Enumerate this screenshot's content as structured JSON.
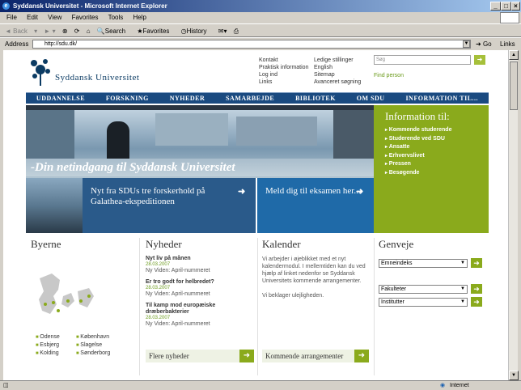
{
  "window": {
    "title": "Syddansk Universitet - Microsoft Internet Explorer"
  },
  "menu": [
    "File",
    "Edit",
    "View",
    "Favorites",
    "Tools",
    "Help"
  ],
  "toolbar": {
    "back": "Back",
    "search": "Search",
    "favorites": "Favorites",
    "history": "History"
  },
  "address": {
    "label": "Address",
    "url": "http://sdu.dk/",
    "go": "Go",
    "links": "Links"
  },
  "status": {
    "zone": "Internet"
  },
  "site": {
    "logo_text": "Syddansk Universitet",
    "toplinks_a": [
      "Kontakt",
      "Praktisk information",
      "Log ind",
      "Links"
    ],
    "toplinks_b": [
      "Ledige stillinger",
      "English",
      "Sitemap",
      "Avanceret søgning"
    ],
    "search_placeholder": "Søg",
    "find_person": "Find person",
    "nav": [
      "UDDANNELSE",
      "FORSKNING",
      "NYHEDER",
      "SAMARBEJDE",
      "BIBLIOTEK",
      "OM SDU",
      "INFORMATION TIL..."
    ],
    "slogan": "-Din netindgang til Syddansk Universitet",
    "info": {
      "title": "Information til:",
      "items": [
        "Kommende studerende",
        "Studerende ved SDU",
        "Ansatte",
        "Erhvervslivet",
        "Pressen",
        "Besøgende"
      ]
    },
    "promo1": "Nyt fra SDUs tre forskerhold på Galathea-ekspeditionen",
    "promo2": "Meld dig til eksamen her...",
    "byerne": {
      "title": "Byerne",
      "cities": [
        "Odense",
        "København",
        "Esbjerg",
        "Slagelse",
        "Kolding",
        "Sønderborg"
      ]
    },
    "nyheder": {
      "title": "Nyheder",
      "items": [
        {
          "title": "Nyt liv på månen",
          "date": "28.03.2007",
          "src": "Ny Viden: April-nummeret"
        },
        {
          "title": "Er tro godt for helbredet?",
          "date": "28.03.2007",
          "src": "Ny Viden: April-nummeret"
        },
        {
          "title": "Til kamp mod europæiske dræberbakterier",
          "date": "28.03.2007",
          "src": "Ny Viden: April-nummeret"
        }
      ],
      "more": "Flere nyheder"
    },
    "kalender": {
      "title": "Kalender",
      "text1": "Vi arbejder i øjeblikket med et nyt kalendermodul. I mellemtiden kan du ved hjælp af linket nedenfor se Syddansk Universitets kommende arrangementer.",
      "text2": "Vi beklager ulejligheden.",
      "more": "Kommende arrangementer"
    },
    "genveje": {
      "title": "Genveje",
      "selects": [
        "Emneindeks",
        "Fakulteter",
        "Institutter"
      ]
    }
  }
}
